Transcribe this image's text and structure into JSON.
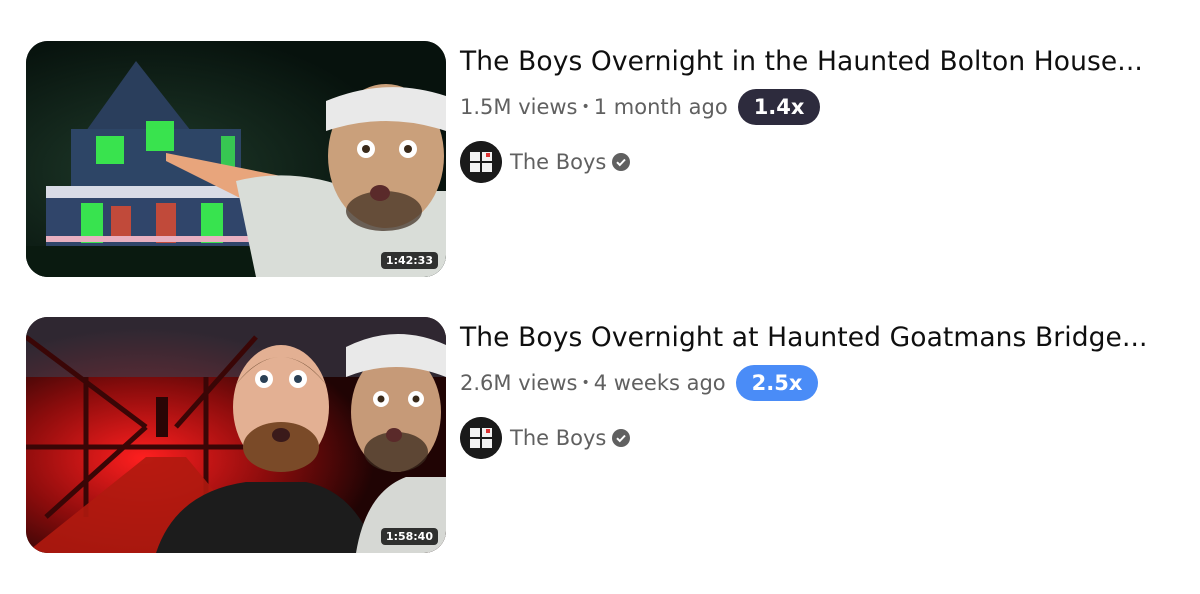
{
  "videos": [
    {
      "title": "The Boys Overnight in the Haunted Bolton House...",
      "views": "1.5M views",
      "age": "1 month ago",
      "speed": "1.4x",
      "speed_color": "#2d2b3d",
      "duration": "1:42:33",
      "channel": "The Boys"
    },
    {
      "title": "The Boys Overnight at Haunted Goatmans Bridge...",
      "views": "2.6M views",
      "age": "4 weeks ago",
      "speed": "2.5x",
      "speed_color": "#4a8cf7",
      "duration": "1:58:40",
      "channel": "The Boys"
    }
  ],
  "separator": "•",
  "icons": {
    "verified": "verified-check-icon",
    "avatar": "channel-avatar"
  }
}
